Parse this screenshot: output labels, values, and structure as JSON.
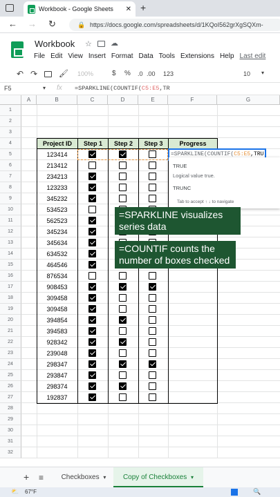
{
  "browser": {
    "tab_title": "Workbook - Google Sheets",
    "url": "https://docs.google.com/spreadsheets/d/1KQoI562grXgSQXm-"
  },
  "app": {
    "title": "Workbook",
    "menu": [
      "File",
      "Edit",
      "View",
      "Insert",
      "Format",
      "Data",
      "Tools",
      "Extensions",
      "Help",
      "Last edit"
    ]
  },
  "toolbar": {
    "zoom": "100%",
    "currency": "$",
    "percent": "%",
    "dec_less": ".0",
    "dec_more": ".00",
    "number_format": "123",
    "font_size": "10"
  },
  "formula_bar": {
    "cell_ref": "F5",
    "fx": "fx",
    "formula_prefix": "=SPARKLINE(COUNTIF(",
    "formula_range": "C5:E5",
    "formula_suffix": ",TR"
  },
  "columns": [
    "A",
    "B",
    "C",
    "D",
    "E",
    "F",
    "G"
  ],
  "rows": [
    "1",
    "2",
    "3",
    "4",
    "5",
    "6",
    "7",
    "8",
    "9",
    "10",
    "11",
    "12",
    "13",
    "14",
    "15",
    "16",
    "17",
    "18",
    "19",
    "20",
    "21",
    "22",
    "23",
    "24",
    "25",
    "26",
    "27",
    "28",
    "29",
    "30",
    "31",
    "32"
  ],
  "table": {
    "headers": [
      "Project ID",
      "Step 1",
      "Step 2",
      "Step 3",
      "Progress"
    ],
    "ids": [
      "123414",
      "213412",
      "234213",
      "123233",
      "345232",
      "534523",
      "562523",
      "345234",
      "345634",
      "634532",
      "464546",
      "876534",
      "908453",
      "309458",
      "309458",
      "394854",
      "394583",
      "928342",
      "239048",
      "298347",
      "293847",
      "298374",
      "192837"
    ],
    "checks": [
      [
        true,
        true,
        false
      ],
      [
        false,
        false,
        false
      ],
      [
        true,
        false,
        false
      ],
      [
        true,
        false,
        false
      ],
      [
        true,
        false,
        false
      ],
      [
        false,
        false,
        false
      ],
      [
        true,
        false,
        false
      ],
      [
        true,
        false,
        false
      ],
      [
        true,
        false,
        false
      ],
      [
        true,
        false,
        false
      ],
      [
        true,
        false,
        false
      ],
      [
        false,
        false,
        false
      ],
      [
        true,
        true,
        true
      ],
      [
        true,
        false,
        false
      ],
      [
        true,
        false,
        false
      ],
      [
        true,
        true,
        false
      ],
      [
        true,
        false,
        false
      ],
      [
        true,
        true,
        false
      ],
      [
        true,
        false,
        false
      ],
      [
        true,
        true,
        true
      ],
      [
        true,
        false,
        false
      ],
      [
        true,
        true,
        false
      ],
      [
        true,
        false,
        false
      ]
    ]
  },
  "editing_cell": {
    "text_prefix": "=SPARKLINE(COUNTIF(",
    "text_range": "C5:E5",
    "text_suffix": ",TRU"
  },
  "autocomplete": {
    "item1": "TRUE",
    "item1_desc": "Logical value true.",
    "item2": "TRUNC",
    "hint": "Tab to accept  ↑ ↓ to navigate"
  },
  "callouts": {
    "sparkline": "=SPARKLINE visualizes series data",
    "countif": "=COUNTIF counts the number of boxes checked"
  },
  "sheets": {
    "add": "+",
    "tab1": "Checkboxes",
    "tab2": "Copy of Checkboxes"
  },
  "taskbar": {
    "weather": "67°F"
  },
  "colors": {
    "header_fill": "#d9ead3",
    "callout_bg": "#1e5631",
    "accent": "#188038",
    "sheets_green": "#0f9d58"
  }
}
